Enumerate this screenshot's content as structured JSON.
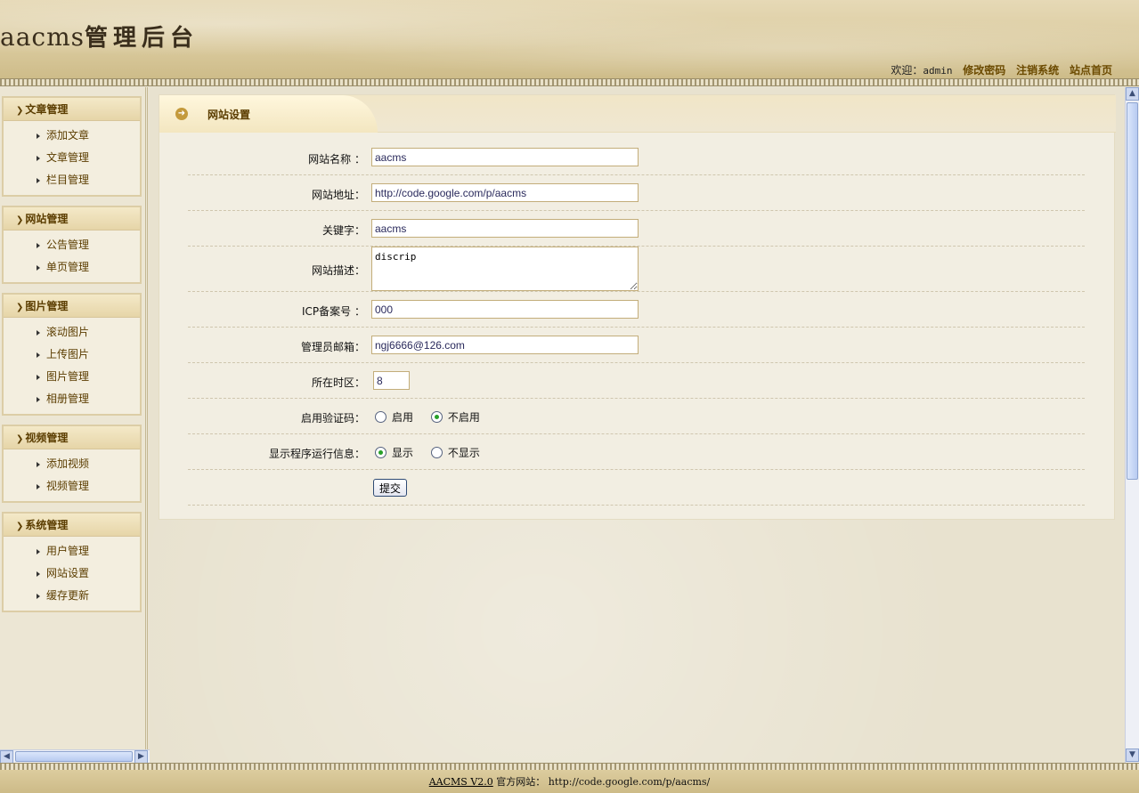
{
  "header": {
    "logo_en": "aacms",
    "logo_zh": "管理后台",
    "welcome": "欢迎：",
    "user": "admin",
    "links": [
      "修改密码",
      "注销系统",
      "站点首页"
    ]
  },
  "sidebar": {
    "groups": [
      {
        "title": "文章管理",
        "items": [
          "添加文章",
          "文章管理",
          "栏目管理"
        ]
      },
      {
        "title": "网站管理",
        "items": [
          "公告管理",
          "单页管理"
        ]
      },
      {
        "title": "图片管理",
        "items": [
          "滚动图片",
          "上传图片",
          "图片管理",
          "相册管理"
        ]
      },
      {
        "title": "视频管理",
        "items": [
          "添加视频",
          "视频管理"
        ]
      },
      {
        "title": "系统管理",
        "items": [
          "用户管理",
          "网站设置",
          "缓存更新"
        ]
      }
    ]
  },
  "panel": {
    "title": "网站设置"
  },
  "form": {
    "site_name": {
      "label": "网站名称 ：",
      "value": "aacms"
    },
    "site_url": {
      "label": "网站地址：",
      "value": "http://code.google.com/p/aacms"
    },
    "keywords": {
      "label": "关键字：",
      "value": "aacms"
    },
    "description": {
      "label": "网站描述：",
      "value": "discrip"
    },
    "icp": {
      "label": "ICP备案号 ：",
      "value": "000"
    },
    "email": {
      "label": "管理员邮箱：",
      "value": "ngj6666@126.com"
    },
    "timezone": {
      "label": "所在时区：",
      "value": "8"
    },
    "captcha": {
      "label": "启用验证码：",
      "options": [
        "启用",
        "不启用"
      ],
      "selected": "不启用"
    },
    "runinfo": {
      "label": "显示程序运行信息：",
      "options": [
        "显示",
        "不显示"
      ],
      "selected": "显示"
    },
    "submit_label": "提交"
  },
  "footer": {
    "version": "AACMS V2.0",
    "official_label": "官方网站：",
    "official_url": "http://code.google.com/p/aacms/"
  }
}
